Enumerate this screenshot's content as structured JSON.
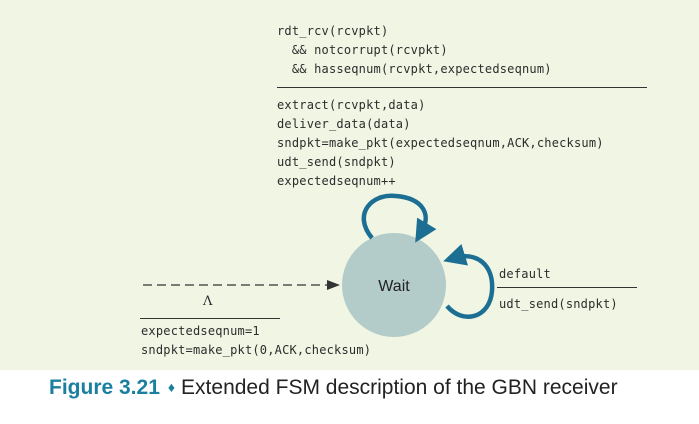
{
  "top_transition": {
    "event_lines": [
      "rdt_rcv(rcvpkt)",
      "  && notcorrupt(rcvpkt)",
      "  && hasseqnum(rcvpkt,expectedseqnum)"
    ],
    "action_lines": [
      "extract(rcvpkt,data)",
      "deliver_data(data)",
      "sndpkt=make_pkt(expectedseqnum,ACK,checksum)",
      "udt_send(sndpkt)",
      "expectedseqnum++"
    ]
  },
  "right_transition": {
    "event": "default",
    "action": "udt_send(sndpkt)"
  },
  "initial_transition": {
    "event": "Λ",
    "action_lines": [
      "expectedseqnum=1",
      "sndpkt=make_pkt(0,ACK,checksum)"
    ]
  },
  "state": {
    "label": "Wait",
    "fill": "#b3cbc9"
  },
  "colors": {
    "background": "#f0f5e4",
    "arrow": "#1c6f93",
    "caption_accent": "#1b7fa0"
  },
  "caption": {
    "number": "Figure 3.21",
    "separator": "♦",
    "text": "Extended FSM description of the GBN receiver"
  }
}
